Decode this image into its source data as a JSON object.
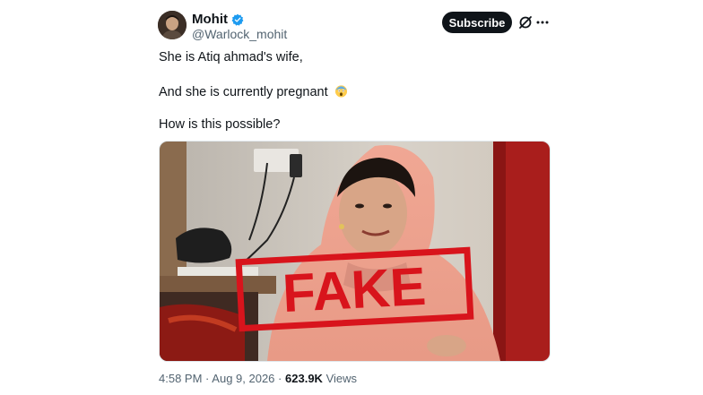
{
  "author": {
    "display_name": "Mohit",
    "handle": "@Warlock_mohit"
  },
  "header": {
    "subscribe_label": "Subscribe"
  },
  "icons": {
    "verified": "verified-badge-icon",
    "grok": "grok-icon",
    "more": "more-options-icon"
  },
  "tweet": {
    "line1": "She is Atiq ahmad's wife,",
    "line2": "And she is currently pregnant",
    "line3": "How is this possible?"
  },
  "media": {
    "stamp_text": "FAKE"
  },
  "meta": {
    "time": "4:58 PM",
    "separator": "·",
    "date": "Aug 9, 2026",
    "views_count": "623.9K",
    "views_label": "Views"
  },
  "colors": {
    "accent": "#1d9bf0",
    "text": "#0f1419",
    "muted": "#536471",
    "stamp_red": "#d8141c"
  }
}
